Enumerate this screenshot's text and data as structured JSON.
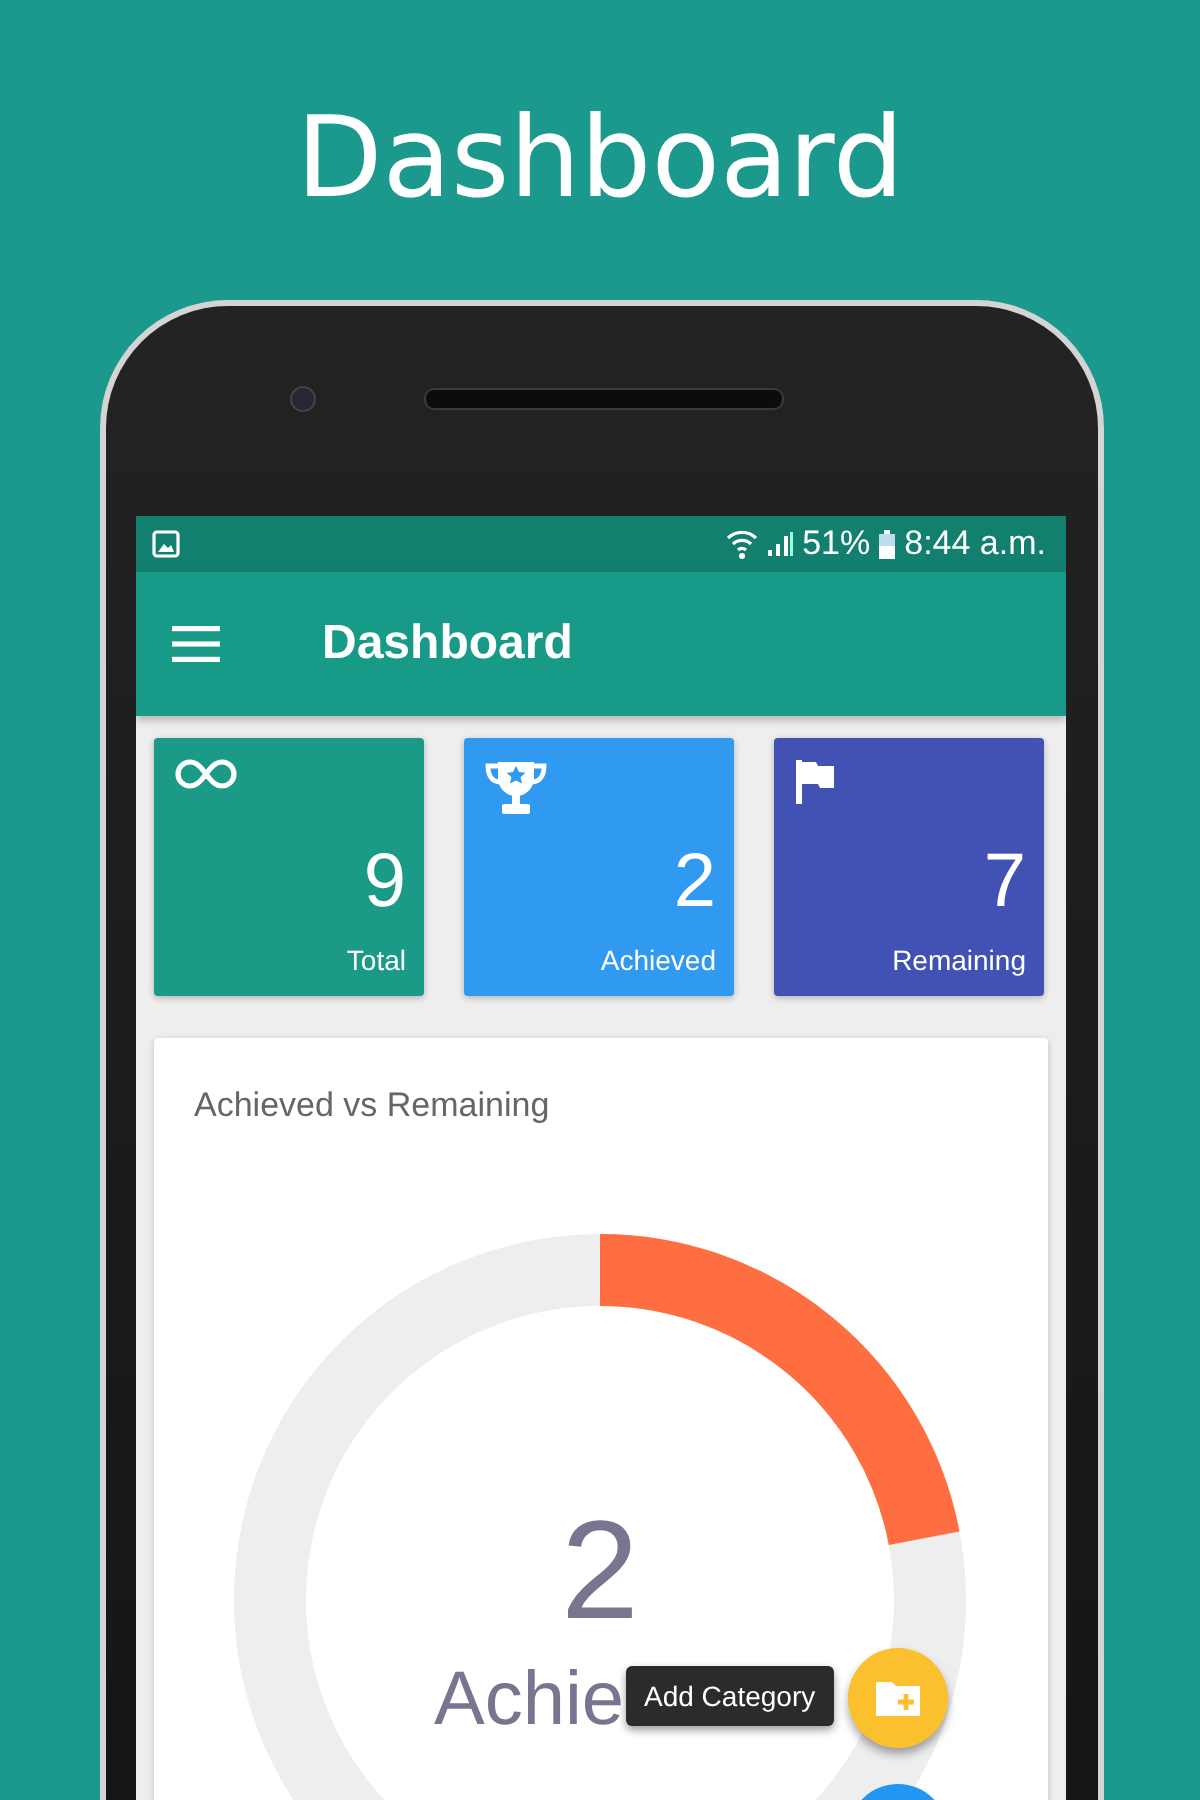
{
  "caption": "Dashboard",
  "status_bar": {
    "battery": "51%",
    "time": "8:44 a.m."
  },
  "app_bar": {
    "title": "Dashboard"
  },
  "stats": [
    {
      "value": "9",
      "label": "Total",
      "color": "#1a9a87"
    },
    {
      "value": "2",
      "label": "Achieved",
      "color": "#2f9af0"
    },
    {
      "value": "7",
      "label": "Remaining",
      "color": "#4152b4"
    }
  ],
  "chart_card": {
    "title": "Achieved vs Remaining",
    "center_value": "2",
    "center_label": "Achie"
  },
  "tooltip": "Add Category"
}
